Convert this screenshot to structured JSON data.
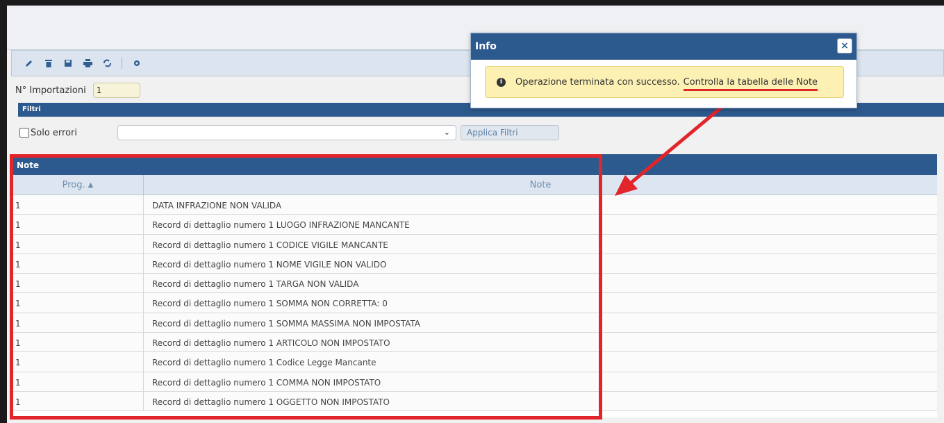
{
  "toolbar": {
    "icons": [
      "pencil-icon",
      "trash-icon",
      "save-icon",
      "print-icon",
      "refresh-icon",
      "gear-icon"
    ]
  },
  "imports": {
    "label": "N° Importazioni",
    "value": "1"
  },
  "filters": {
    "header": "Filtri",
    "checkbox_label": "Solo errori",
    "select_value": "",
    "apply_label": "Applica Filtri"
  },
  "note_table": {
    "title": "Note",
    "columns": [
      "Prog.",
      "Note"
    ],
    "rows": [
      {
        "prog": "1",
        "note": "DATA INFRAZIONE NON VALIDA"
      },
      {
        "prog": "1",
        "note": "Record di dettaglio numero 1 LUOGO INFRAZIONE MANCANTE"
      },
      {
        "prog": "1",
        "note": "Record di dettaglio numero 1 CODICE VIGILE MANCANTE"
      },
      {
        "prog": "1",
        "note": "Record di dettaglio numero 1 NOME VIGILE NON VALIDO"
      },
      {
        "prog": "1",
        "note": "Record di dettaglio numero 1 TARGA NON VALIDA"
      },
      {
        "prog": "1",
        "note": "Record di dettaglio numero 1 SOMMA NON CORRETTA: 0"
      },
      {
        "prog": "1",
        "note": "Record di dettaglio numero 1 SOMMA MASSIMA NON IMPOSTATA"
      },
      {
        "prog": "1",
        "note": "Record di dettaglio numero 1 ARTICOLO NON IMPOSTATO"
      },
      {
        "prog": "1",
        "note": "Record di dettaglio numero 1 Codice Legge Mancante"
      },
      {
        "prog": "1",
        "note": "Record di dettaglio numero 1 COMMA NON IMPOSTATO"
      },
      {
        "prog": "1",
        "note": "Record di dettaglio numero 1 OGGETTO NON IMPOSTATO"
      }
    ]
  },
  "dialog": {
    "title": "Info",
    "close_label": "×",
    "message": "Operazione terminata con successo.",
    "message_link": "Controlla la tabella delle Note"
  },
  "colors": {
    "header_blue": "#2d5a8e",
    "annotation_red": "#e2242b",
    "warning_bg": "#fcf0b3"
  }
}
